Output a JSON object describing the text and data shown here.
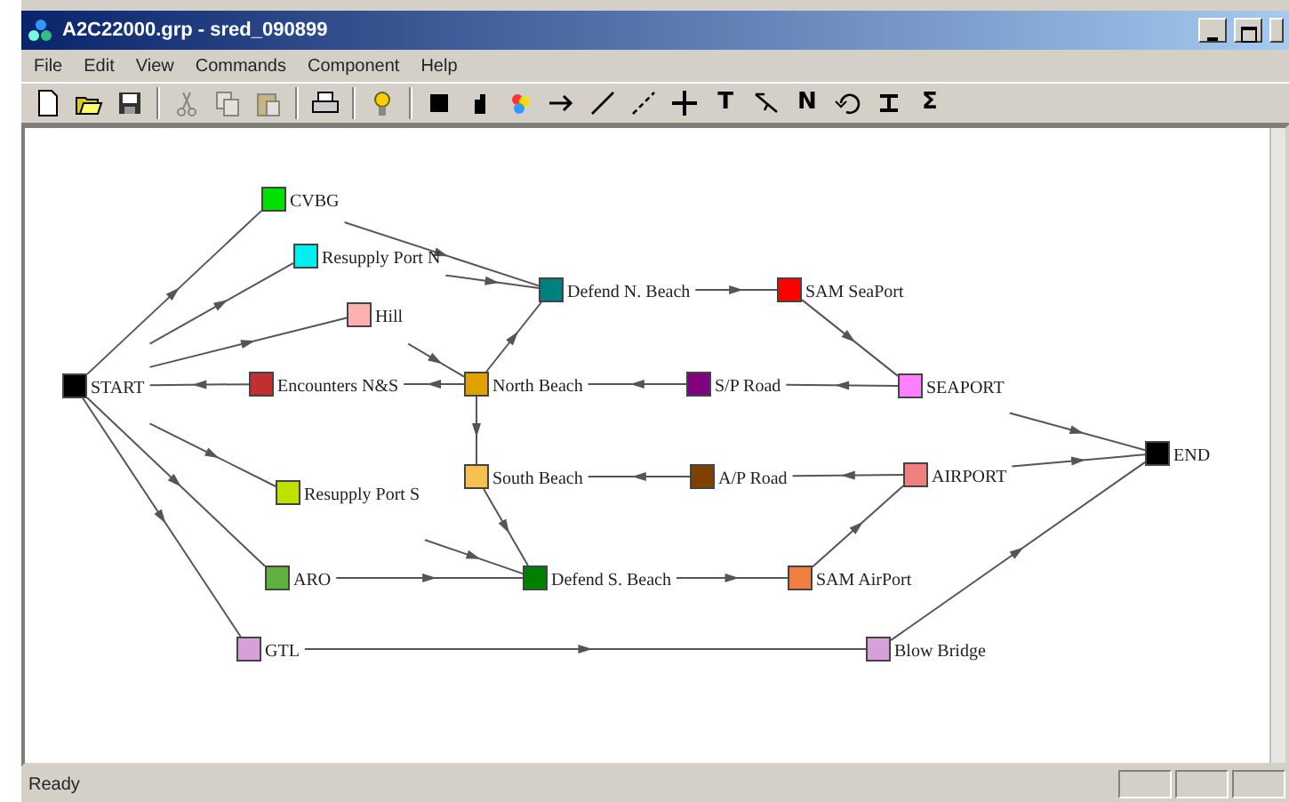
{
  "window": {
    "title": "A2C22000.grp - sred_090899"
  },
  "menu": [
    "File",
    "Edit",
    "View",
    "Commands",
    "Component",
    "Help"
  ],
  "toolbar": [
    {
      "kind": "new",
      "disabled": false
    },
    {
      "kind": "open",
      "disabled": false
    },
    {
      "kind": "save",
      "disabled": false
    },
    {
      "kind": "sep"
    },
    {
      "kind": "cut",
      "disabled": true
    },
    {
      "kind": "copy",
      "disabled": true
    },
    {
      "kind": "paste",
      "disabled": true
    },
    {
      "kind": "sep"
    },
    {
      "kind": "print",
      "disabled": false
    },
    {
      "kind": "sep"
    },
    {
      "kind": "bulb",
      "disabled": false
    },
    {
      "kind": "sep"
    },
    {
      "kind": "square",
      "disabled": false
    },
    {
      "kind": "note",
      "disabled": false
    },
    {
      "kind": "palette",
      "disabled": false
    },
    {
      "kind": "arrow",
      "disabled": false
    },
    {
      "kind": "line",
      "disabled": false
    },
    {
      "kind": "dashline",
      "disabled": false
    },
    {
      "kind": "plus",
      "disabled": false
    },
    {
      "kind": "glyph",
      "text": "T",
      "disabled": false
    },
    {
      "kind": "diag",
      "disabled": false
    },
    {
      "kind": "glyph",
      "text": "N",
      "disabled": false
    },
    {
      "kind": "undo",
      "disabled": false
    },
    {
      "kind": "merge",
      "disabled": false
    },
    {
      "kind": "glyph",
      "text": "Σ",
      "disabled": false
    }
  ],
  "diagram": {
    "nodes": [
      {
        "label": "START",
        "color": "#000000"
      },
      {
        "label": "CVBG",
        "color": "#00e000"
      },
      {
        "label": "Resupply Port N",
        "color": "#00f0f0"
      },
      {
        "label": "Hill",
        "color": "#ffb0b0"
      },
      {
        "label": "Encounters N&S",
        "color": "#c03030"
      },
      {
        "label": "North Beach",
        "color": "#e0a000"
      },
      {
        "label": "Defend N. Beach",
        "color": "#008080"
      },
      {
        "label": "SAM SeaPort",
        "color": "#ff0000"
      },
      {
        "label": "S/P Road",
        "color": "#800080"
      },
      {
        "label": "SEAPORT",
        "color": "#ff80ff"
      },
      {
        "label": "South Beach",
        "color": "#f8c050"
      },
      {
        "label": "Resupply Port S",
        "color": "#c0e000"
      },
      {
        "label": "A/P Road",
        "color": "#804000"
      },
      {
        "label": "AIRPORT",
        "color": "#f08080"
      },
      {
        "label": "END",
        "color": "#000000"
      },
      {
        "label": "ARO",
        "color": "#60b040"
      },
      {
        "label": "Defend S. Beach",
        "color": "#008000"
      },
      {
        "label": "SAM AirPort",
        "color": "#f08040"
      },
      {
        "label": "GTL",
        "color": "#d8a0d8"
      },
      {
        "label": "Blow Bridge",
        "color": "#d8a0d8"
      }
    ]
  },
  "status_bar": {
    "text": "Ready"
  }
}
